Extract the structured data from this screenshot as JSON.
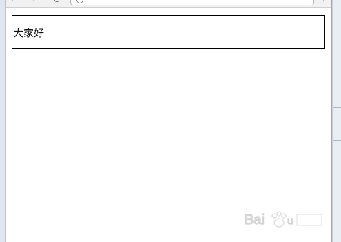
{
  "browser": {
    "address_text": "",
    "nav": {
      "back": "←",
      "forward": "→",
      "reload": "C"
    },
    "menu": "⋮"
  },
  "page": {
    "box_text": "大家好"
  },
  "colors": {
    "box_border": "#000000",
    "page_background": "#ffffff",
    "frame": "#dfe6ee"
  },
  "icons": [
    "info-icon",
    "bookmark-icon",
    "menu-icon"
  ]
}
